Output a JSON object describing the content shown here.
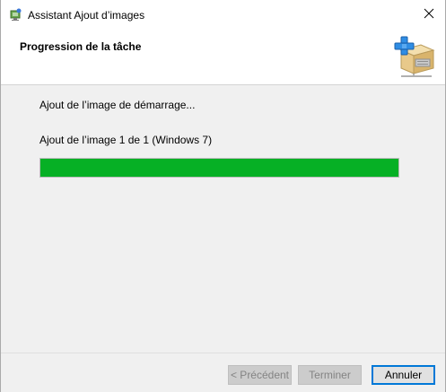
{
  "window": {
    "title": "Assistant Ajout d’images",
    "close_icon": "close-icon"
  },
  "header": {
    "title": "Progression de la tâche",
    "icon": "add-image-box-icon"
  },
  "content": {
    "status_line_1": "Ajout de l’image de démarrage...",
    "status_line_2": "Ajout de l’image 1 de 1 (Windows 7)",
    "progress_percent": 100,
    "progress_color": "#06b025"
  },
  "buttons": {
    "previous_label": "< Précédent",
    "finish_label": "Terminer",
    "cancel_label": "Annuler"
  },
  "colors": {
    "accent": "#0078d7",
    "disabled_button": "#cccccc"
  }
}
